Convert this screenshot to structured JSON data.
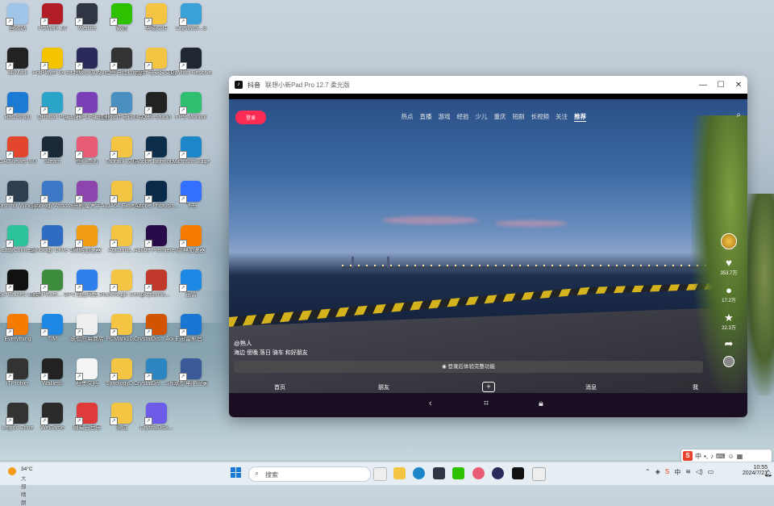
{
  "desktop": {
    "icons": [
      {
        "label": "回收站",
        "color": "#9fc5e8",
        "col": 0,
        "row": 0
      },
      {
        "label": "PCMark 10",
        "color": "#b01d24",
        "col": 1,
        "row": 0
      },
      {
        "label": "Weiline",
        "color": "#2f3542",
        "col": 2,
        "row": 0
      },
      {
        "label": "微信",
        "color": "#2dc100",
        "col": 3,
        "row": 0
      },
      {
        "label": "华硕文件",
        "color": "#f4c542",
        "col": 4,
        "row": 0
      },
      {
        "label": "CrystalDi...8",
        "color": "#3aa0d8",
        "col": 5,
        "row": 0
      },
      {
        "label": "3DMark",
        "color": "#222",
        "col": 0,
        "row": 1
      },
      {
        "label": "PotPlayer 64 bit",
        "color": "#f5c400",
        "col": 1,
        "row": 1
      },
      {
        "label": "超级小游戏",
        "color": "#2b2b5b",
        "col": 2,
        "row": 1
      },
      {
        "label": "AI绘图与建模助手",
        "color": "#333",
        "col": 3,
        "row": 1
      },
      {
        "label": "设计与安装文档",
        "color": "#f4c542",
        "col": 4,
        "row": 1
      },
      {
        "label": "DaVinci Resolve",
        "color": "#1f2733",
        "col": 5,
        "row": 1
      },
      {
        "label": "BatDisrupt",
        "color": "#1a7ad4",
        "col": 0,
        "row": 2
      },
      {
        "label": "QRadar Pro",
        "color": "#2aa4c8",
        "col": 1,
        "row": 2
      },
      {
        "label": "编辑器PDF编辑器",
        "color": "#7b3fb8",
        "col": 2,
        "row": 2
      },
      {
        "label": "工业设计与行业学习平台",
        "color": "#4a8fc1",
        "col": 3,
        "row": 2
      },
      {
        "label": "OBS Studio",
        "color": "#222",
        "col": 4,
        "row": 2
      },
      {
        "label": "FPS Monitor",
        "color": "#2fbf71",
        "col": 5,
        "row": 2
      },
      {
        "label": "CAJViewer 9.0",
        "color": "#e2462c",
        "col": 0,
        "row": 3
      },
      {
        "label": "Steam",
        "color": "#1b2838",
        "col": 1,
        "row": 3
      },
      {
        "label": "图片查看",
        "color": "#e85d75",
        "col": 2,
        "row": 3
      },
      {
        "label": "Tabrack 文件",
        "color": "#f4c542",
        "col": 3,
        "row": 3
      },
      {
        "label": "Adobe Lightroo...",
        "color": "#0d2e4a",
        "col": 4,
        "row": 3
      },
      {
        "label": "Microsoft Edge",
        "color": "#1c86c8",
        "col": 5,
        "row": 3
      },
      {
        "label": "Clash for Windows",
        "color": "#2c3e50",
        "col": 0,
        "row": 4
      },
      {
        "label": "Synology Assistant",
        "color": "#3b79c6",
        "col": 1,
        "row": 4
      },
      {
        "label": "光影魔术手",
        "color": "#8e44ad",
        "col": 2,
        "row": 4
      },
      {
        "label": "AIDA64 Extreme",
        "color": "#f4c542",
        "col": 3,
        "row": 4
      },
      {
        "label": "Adobe Photosh...",
        "color": "#0a2a4a",
        "col": 4,
        "row": 4
      },
      {
        "label": "飞书",
        "color": "#3370ff",
        "col": 5,
        "row": 4
      },
      {
        "label": "EasyConnect",
        "color": "#2dc39a",
        "col": 0,
        "row": 5
      },
      {
        "label": "Synology Drive Client",
        "color": "#2e6cc4",
        "col": 1,
        "row": 5
      },
      {
        "label": "网络加速器",
        "color": "#f39c12",
        "col": 2,
        "row": 5
      },
      {
        "label": "Aquantia...",
        "color": "#f4c542",
        "col": 3,
        "row": 5
      },
      {
        "label": "Adobe Premiere P...",
        "color": "#2a0b4a",
        "col": 4,
        "row": 5
      },
      {
        "label": "雷神加速器",
        "color": "#f57c00",
        "col": 5,
        "row": 5
      },
      {
        "label": "Epic Games Launcher",
        "color": "#111",
        "col": 0,
        "row": 6
      },
      {
        "label": "TechPower... GPU-Z",
        "color": "#3d8b3d",
        "col": 1,
        "row": 6
      },
      {
        "label": "百度网盘",
        "color": "#2f80ed",
        "col": 2,
        "row": 6
      },
      {
        "label": "Blackmagic Design De...",
        "color": "#f4c542",
        "col": 3,
        "row": 6
      },
      {
        "label": "Aquantia...",
        "color": "#c0392b",
        "col": 4,
        "row": 6
      },
      {
        "label": "迅雷",
        "color": "#1e88e5",
        "col": 5,
        "row": 6
      },
      {
        "label": "Everything",
        "color": "#f57c00",
        "col": 0,
        "row": 7
      },
      {
        "label": "TIM",
        "color": "#1e88e5",
        "col": 1,
        "row": 7
      },
      {
        "label": "联想应用商店",
        "color": "#eee",
        "col": 2,
        "row": 7
      },
      {
        "label": "PCMark10...",
        "color": "#f4c542",
        "col": 3,
        "row": 7
      },
      {
        "label": "CrystalDis... Aoi Edition",
        "color": "#d35400",
        "col": 4,
        "row": 7
      },
      {
        "label": "迅雷影音",
        "color": "#1976d2",
        "col": 5,
        "row": 7
      },
      {
        "label": "iTProfiler",
        "color": "#333",
        "col": 0,
        "row": 8
      },
      {
        "label": "Wallless",
        "color": "#222",
        "col": 1,
        "row": 8
      },
      {
        "label": "石墨文档",
        "color": "#f5f5f5",
        "col": 2,
        "row": 8
      },
      {
        "label": "SynologyD...",
        "color": "#f4c542",
        "col": 3,
        "row": 8
      },
      {
        "label": "CrystalDis... Shizuku Ed...",
        "color": "#2e86c1",
        "col": 4,
        "row": 8
      },
      {
        "label": "联想电脑管家",
        "color": "#3b5998",
        "col": 5,
        "row": 8
      },
      {
        "label": "Legion Zone",
        "color": "#333",
        "col": 0,
        "row": 9
      },
      {
        "label": "WeGame",
        "color": "#2b2b2b",
        "col": 1,
        "row": 9
      },
      {
        "label": "网易云音乐",
        "color": "#e03b3b",
        "col": 2,
        "row": 9
      },
      {
        "label": "测试",
        "color": "#f4c542",
        "col": 3,
        "row": 9
      },
      {
        "label": "CrystalDisk...",
        "color": "#6c5ce7",
        "col": 4,
        "row": 9
      }
    ]
  },
  "window": {
    "app_icon": "tiktok-icon",
    "title": "抖音",
    "subtitle": "联想小新Pad Pro 12.7 柔光版",
    "controls": [
      "—",
      "☐",
      "✕"
    ]
  },
  "video": {
    "login_label": "登录",
    "nav": [
      "热点",
      "直播",
      "游戏",
      "经验",
      "少儿",
      "重庆",
      "短剧",
      "长视频",
      "关注",
      "推荐"
    ],
    "active_nav": "推荐",
    "side": {
      "likes": "353.7万",
      "comments": "17.2万",
      "favorites": "22.3万"
    },
    "author": "@熟人",
    "caption": "海边 傍晚 落日 骑车 和好朋友",
    "login_prompt": "登录后体验完整功能",
    "tabs": {
      "home": "首页",
      "friends": "朋友",
      "messages": "消息",
      "me": "我"
    }
  },
  "ime": {
    "logo": "S",
    "mode": "中"
  },
  "taskbar": {
    "weather_temp": "34°C",
    "weather_desc": "大部晴朗",
    "search_placeholder": "搜索",
    "time": "10:55",
    "date": "2024/7/21"
  }
}
